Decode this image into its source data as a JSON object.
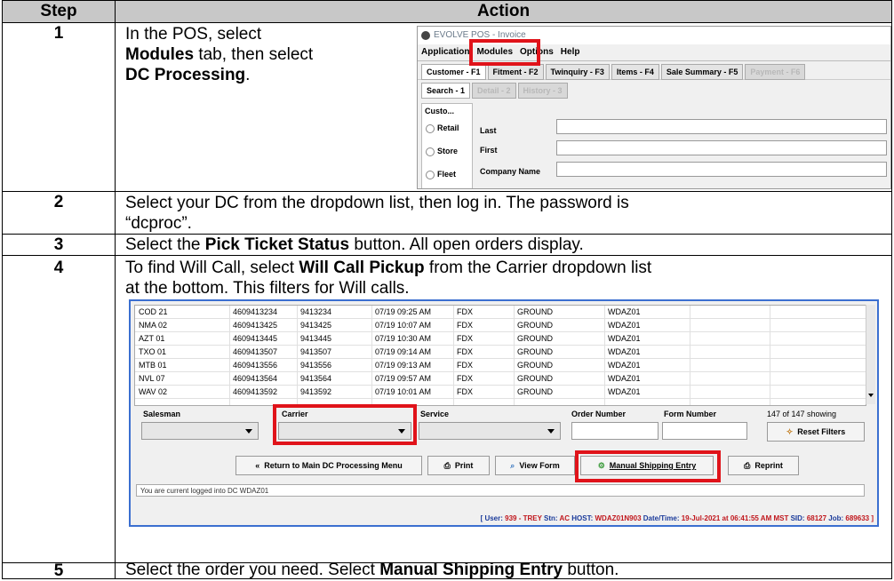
{
  "header": {
    "step": "Step",
    "action": "Action"
  },
  "steps": [
    {
      "num": "1",
      "text_a": "In the POS, select",
      "text_b_bold": "Modules",
      "text_b_rest": " tab, then select",
      "text_c_bold": "DC Processing",
      "text_c_rest": "."
    },
    {
      "num": "2",
      "line1": "Select your DC from the dropdown list, then log in. The password is",
      "line2": "“dcproc”."
    },
    {
      "num": "3",
      "text_a": "Select the ",
      "text_bold": "Pick Ticket Status",
      "text_b": " button.  All open orders display."
    },
    {
      "num": "4",
      "l1_a": "To find Will Call, select ",
      "l1_bold": "Will Call Pickup",
      "l1_b": " from the Carrier dropdown list",
      "line2": "at the bottom.  This filters for Will calls."
    },
    {
      "num": "5",
      "text_a": "Select the order you need.   Select ",
      "text_bold": "Manual Shipping Entry",
      "text_b": " button."
    }
  ],
  "pos": {
    "title": "EVOLVE POS - Invoice",
    "menu": [
      "Application",
      "Modules",
      "Options",
      "Help"
    ],
    "tabs": [
      "Customer - F1",
      "Fitment - F2",
      "Twinquiry - F3",
      "Items - F4",
      "Sale Summary - F5",
      "Payment - F6"
    ],
    "subtabs": [
      "Search - 1",
      "Detail - 2",
      "History - 3"
    ],
    "panel_title": "Custo...",
    "radios": [
      "Retail",
      "Store",
      "Fleet"
    ],
    "fields": [
      "Last",
      "First",
      "Company Name"
    ]
  },
  "dc": {
    "rows": [
      [
        "COD 21",
        "4609413234",
        "9413234",
        "07/19 09:25 AM",
        "FDX",
        "GROUND",
        "WDAZ01"
      ],
      [
        "NMA 02",
        "4609413425",
        "9413425",
        "07/19 10:07 AM",
        "FDX",
        "GROUND",
        "WDAZ01"
      ],
      [
        "AZT 01",
        "4609413445",
        "9413445",
        "07/19 10:30 AM",
        "FDX",
        "GROUND",
        "WDAZ01"
      ],
      [
        "TXO 01",
        "4609413507",
        "9413507",
        "07/19 09:14 AM",
        "FDX",
        "GROUND",
        "WDAZ01"
      ],
      [
        "MTB 01",
        "4609413556",
        "9413556",
        "07/19 09:13 AM",
        "FDX",
        "GROUND",
        "WDAZ01"
      ],
      [
        "NVL 07",
        "4609413564",
        "9413564",
        "07/19 09:57 AM",
        "FDX",
        "GROUND",
        "WDAZ01"
      ],
      [
        "WAV 02",
        "4609413592",
        "9413592",
        "07/19 10:01 AM",
        "FDX",
        "GROUND",
        "WDAZ01"
      ]
    ],
    "labels": {
      "salesman": "Salesman",
      "carrier": "Carrier",
      "service": "Service",
      "order_number": "Order Number",
      "form_number": "Form Number",
      "showing": "147 of 147 showing"
    },
    "buttons": {
      "reset": "Reset Filters",
      "return": "Return to Main DC Processing Menu",
      "print": "Print",
      "view_form": "View Form",
      "manual": "Manual Shipping Entry",
      "reprint": "Reprint"
    },
    "status": "You are current logged into DC WDAZ01",
    "footer": {
      "user_lbl": "[ User: ",
      "user": "939 - TREY",
      "stn_lbl": "  Stn: ",
      "stn": "AC",
      "host_lbl": "  HOST: ",
      "host": "WDAZ01N903",
      "dt_lbl": "  Date/Time: ",
      "dt": "19-Jul-2021 at 06:41:55 AM MST",
      "sid_lbl": "  SID: ",
      "sid": "68127",
      "job_lbl": "  Job: ",
      "job": "689633 ]"
    }
  }
}
